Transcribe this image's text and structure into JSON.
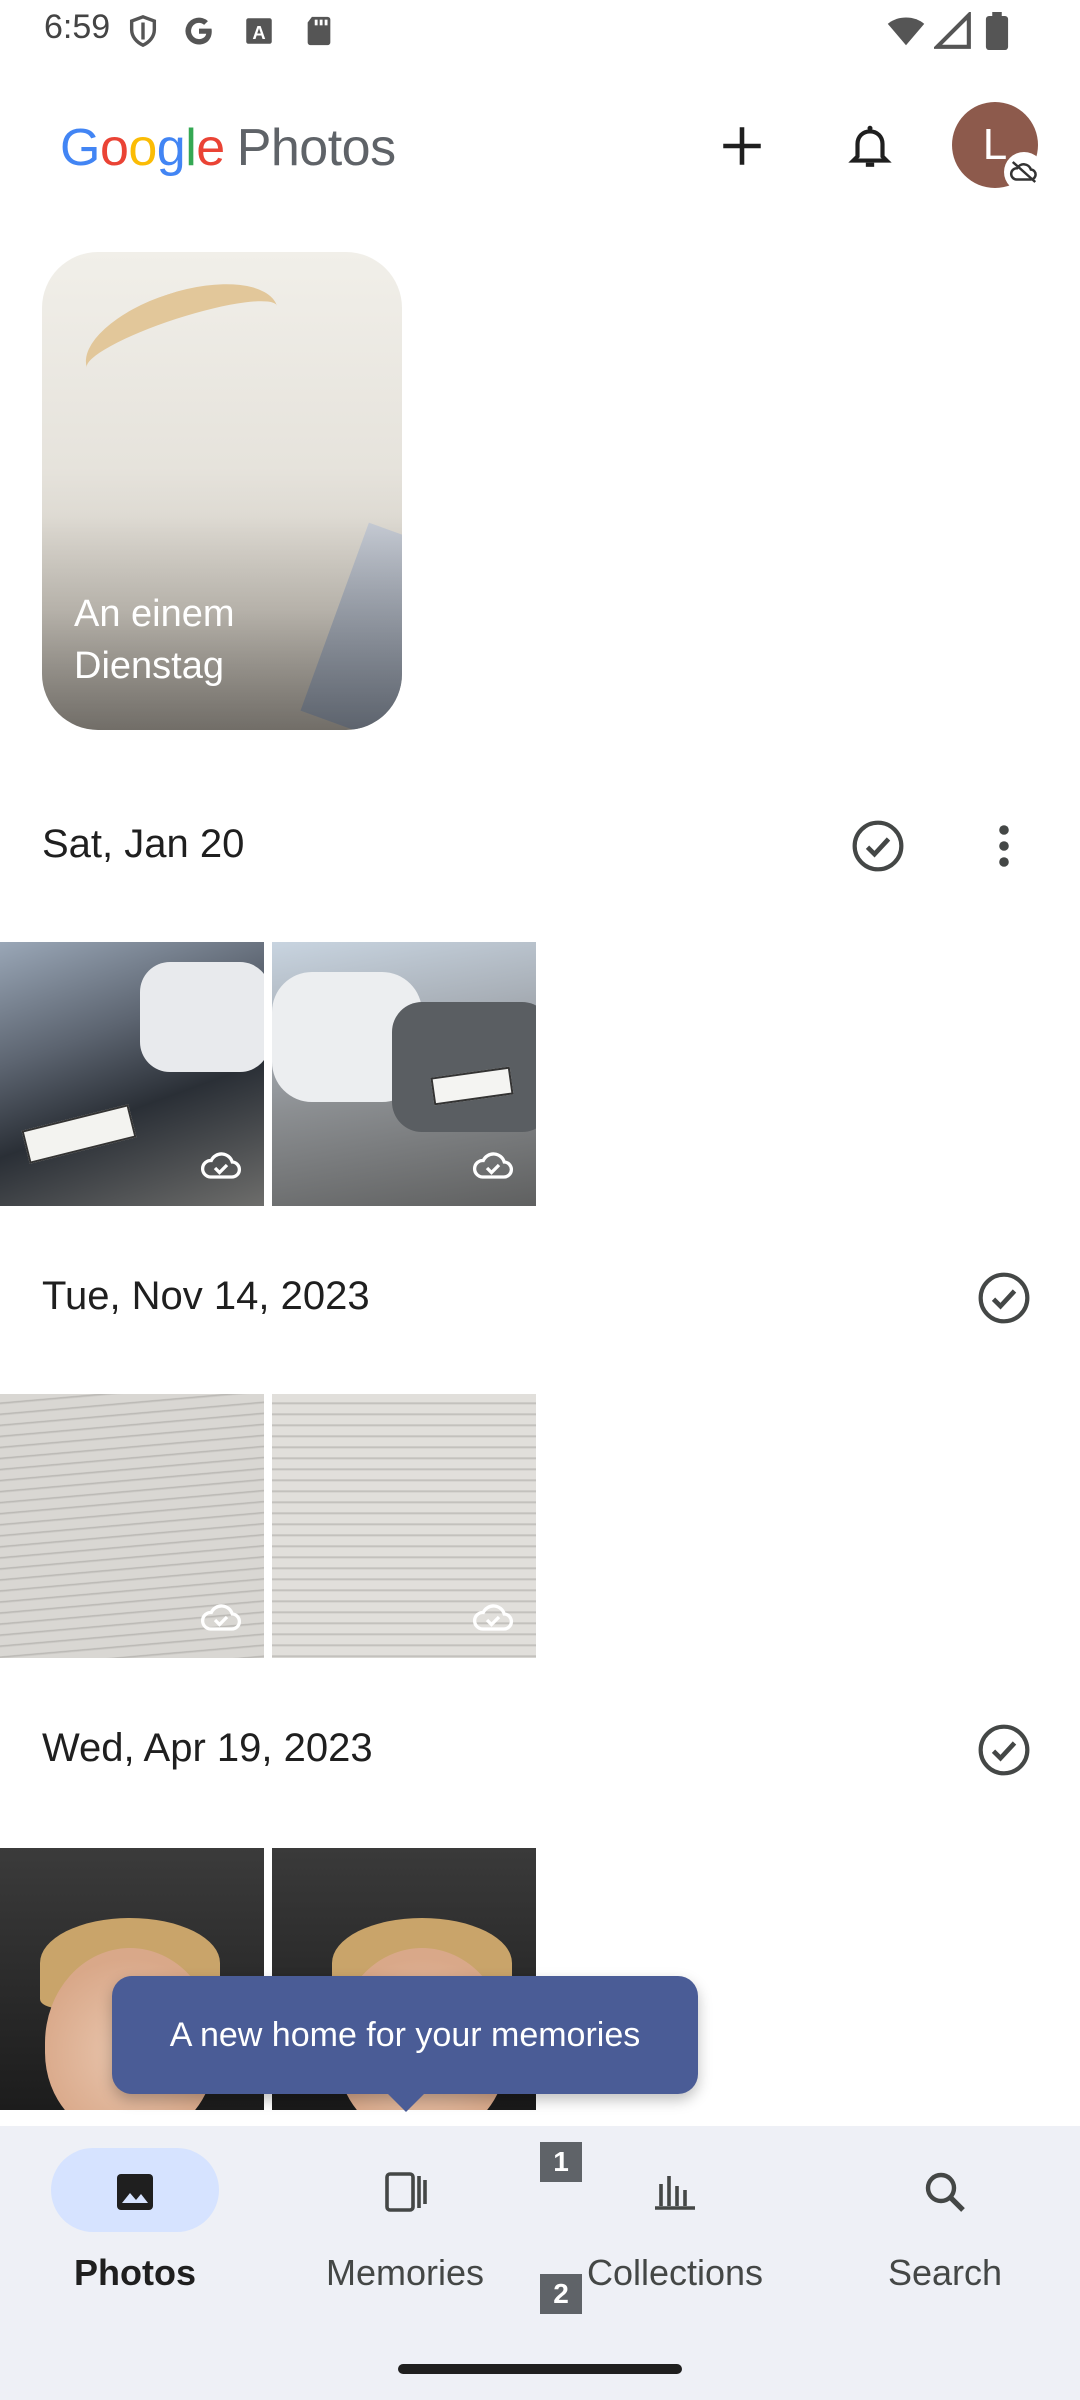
{
  "status_bar": {
    "time": "6:59",
    "left_icons": [
      "shield-icon",
      "google-icon",
      "font-icon",
      "sd-card-icon"
    ],
    "right_icons": [
      "wifi-icon",
      "signal-icon",
      "battery-icon"
    ]
  },
  "app_bar": {
    "logo_google": [
      "G",
      "o",
      "o",
      "g",
      "l",
      "e"
    ],
    "logo_product": "Photos",
    "add_icon": "plus-icon",
    "notifications_icon": "bell-icon",
    "avatar_initial": "L",
    "avatar_badge_icon": "cloud-off-icon"
  },
  "memory": {
    "title": "An einem Dienstag"
  },
  "sections": [
    {
      "date": "Sat, Jan 20",
      "has_more": true
    },
    {
      "date": "Tue, Nov 14, 2023",
      "has_more": false
    },
    {
      "date": "Wed, Apr 19, 2023",
      "has_more": false
    }
  ],
  "tooltip": {
    "text": "A new home for your memories"
  },
  "bottom_nav": {
    "items": [
      {
        "label": "Photos",
        "icon": "photo-icon",
        "active": true
      },
      {
        "label": "Memories",
        "icon": "memories-icon",
        "active": false
      },
      {
        "label": "Collections",
        "icon": "collections-icon",
        "active": false
      },
      {
        "label": "Search",
        "icon": "search-icon",
        "active": false
      }
    ],
    "badges": [
      "1",
      "2"
    ]
  },
  "colors": {
    "accent_pill": "#d6e3ff",
    "tooltip_bg": "#4a5c96",
    "nav_bg": "#eef0f6",
    "avatar_bg": "#8d5a4c"
  }
}
